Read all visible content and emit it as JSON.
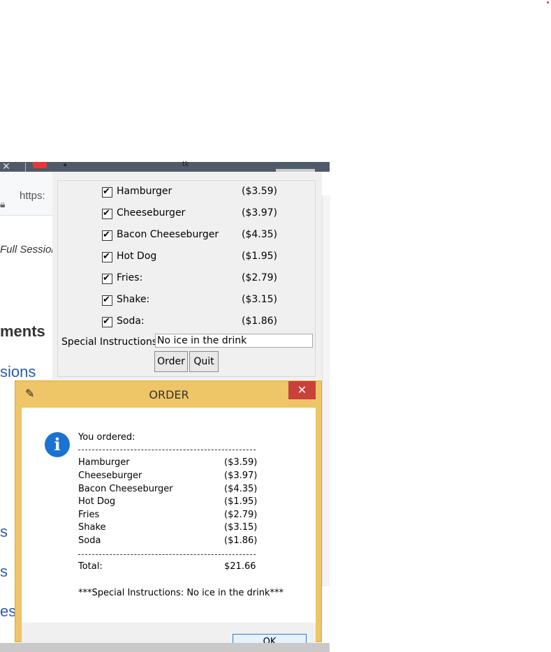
{
  "browser": {
    "url_fragment": "https:",
    "session_fragment": "Full Session",
    "heading_fragment": "ments",
    "link_fragment_1": "sions",
    "link_fragment_2": "s",
    "link_fragment_3": "s",
    "link_fragment_4": "es"
  },
  "main_window": {
    "title_fragment": "tk",
    "items": [
      {
        "name": "Hamburger",
        "price": "($3.59)"
      },
      {
        "name": "Cheeseburger",
        "price": "($3.97)"
      },
      {
        "name": "Bacon Cheeseburger",
        "price": "($4.35)"
      },
      {
        "name": "Hot Dog",
        "price": "($1.95)"
      },
      {
        "name": "Fries:",
        "price": "($2.79)"
      },
      {
        "name": "Shake:",
        "price": "($3.15)"
      },
      {
        "name": "Soda:",
        "price": "($1.86)"
      }
    ],
    "special_label": "Special Instructions:",
    "special_value": "No ice in the drink",
    "order_button": "Order",
    "quit_button": "Quit"
  },
  "dialog": {
    "title": "ORDER",
    "close_glyph": "✕",
    "icon_glyph": "i",
    "intro": "You ordered:",
    "separator": "----------------------------------------",
    "lines": [
      {
        "name": "Hamburger",
        "price": "($3.59)"
      },
      {
        "name": "Cheeseburger",
        "price": "($3.97)"
      },
      {
        "name": "Bacon Cheeseburger",
        "price": "($4.35)"
      },
      {
        "name": "Hot Dog",
        "price": "($1.95)"
      },
      {
        "name": "Fries",
        "price": "($2.79)"
      },
      {
        "name": "Shake",
        "price": "($3.15)"
      },
      {
        "name": "Soda",
        "price": "($1.86)"
      }
    ],
    "total_label": "Total:",
    "total_value": "$21.66",
    "special_line": "***Special Instructions: No ice in the drink***",
    "ok_button": "OK"
  },
  "colors": {
    "dialog_frame": "#eec567",
    "close_button": "#c8413b",
    "info_icon": "#1a73d1",
    "link": "#2d5bb0"
  }
}
